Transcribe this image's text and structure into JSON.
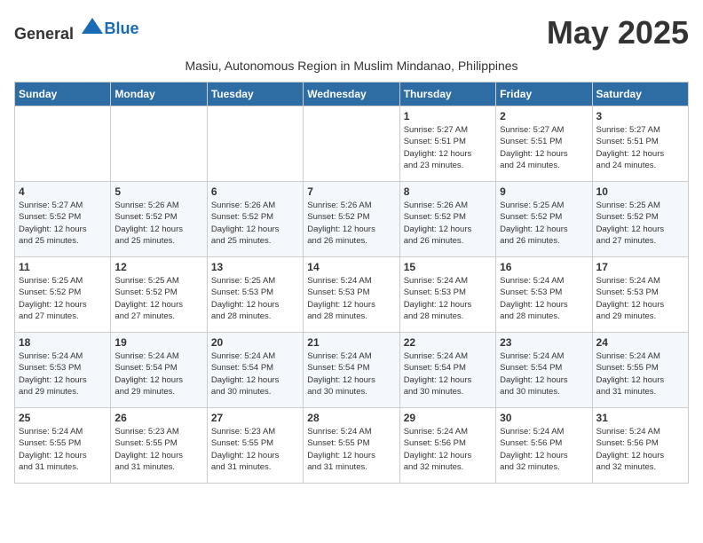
{
  "logo": {
    "general": "General",
    "blue": "Blue"
  },
  "title": "May 2025",
  "subtitle": "Masiu, Autonomous Region in Muslim Mindanao, Philippines",
  "days_of_week": [
    "Sunday",
    "Monday",
    "Tuesday",
    "Wednesday",
    "Thursday",
    "Friday",
    "Saturday"
  ],
  "weeks": [
    [
      {
        "day": "",
        "info": ""
      },
      {
        "day": "",
        "info": ""
      },
      {
        "day": "",
        "info": ""
      },
      {
        "day": "",
        "info": ""
      },
      {
        "day": "1",
        "info": "Sunrise: 5:27 AM\nSunset: 5:51 PM\nDaylight: 12 hours\nand 23 minutes."
      },
      {
        "day": "2",
        "info": "Sunrise: 5:27 AM\nSunset: 5:51 PM\nDaylight: 12 hours\nand 24 minutes."
      },
      {
        "day": "3",
        "info": "Sunrise: 5:27 AM\nSunset: 5:51 PM\nDaylight: 12 hours\nand 24 minutes."
      }
    ],
    [
      {
        "day": "4",
        "info": "Sunrise: 5:27 AM\nSunset: 5:52 PM\nDaylight: 12 hours\nand 25 minutes."
      },
      {
        "day": "5",
        "info": "Sunrise: 5:26 AM\nSunset: 5:52 PM\nDaylight: 12 hours\nand 25 minutes."
      },
      {
        "day": "6",
        "info": "Sunrise: 5:26 AM\nSunset: 5:52 PM\nDaylight: 12 hours\nand 25 minutes."
      },
      {
        "day": "7",
        "info": "Sunrise: 5:26 AM\nSunset: 5:52 PM\nDaylight: 12 hours\nand 26 minutes."
      },
      {
        "day": "8",
        "info": "Sunrise: 5:26 AM\nSunset: 5:52 PM\nDaylight: 12 hours\nand 26 minutes."
      },
      {
        "day": "9",
        "info": "Sunrise: 5:25 AM\nSunset: 5:52 PM\nDaylight: 12 hours\nand 26 minutes."
      },
      {
        "day": "10",
        "info": "Sunrise: 5:25 AM\nSunset: 5:52 PM\nDaylight: 12 hours\nand 27 minutes."
      }
    ],
    [
      {
        "day": "11",
        "info": "Sunrise: 5:25 AM\nSunset: 5:52 PM\nDaylight: 12 hours\nand 27 minutes."
      },
      {
        "day": "12",
        "info": "Sunrise: 5:25 AM\nSunset: 5:52 PM\nDaylight: 12 hours\nand 27 minutes."
      },
      {
        "day": "13",
        "info": "Sunrise: 5:25 AM\nSunset: 5:53 PM\nDaylight: 12 hours\nand 28 minutes."
      },
      {
        "day": "14",
        "info": "Sunrise: 5:24 AM\nSunset: 5:53 PM\nDaylight: 12 hours\nand 28 minutes."
      },
      {
        "day": "15",
        "info": "Sunrise: 5:24 AM\nSunset: 5:53 PM\nDaylight: 12 hours\nand 28 minutes."
      },
      {
        "day": "16",
        "info": "Sunrise: 5:24 AM\nSunset: 5:53 PM\nDaylight: 12 hours\nand 28 minutes."
      },
      {
        "day": "17",
        "info": "Sunrise: 5:24 AM\nSunset: 5:53 PM\nDaylight: 12 hours\nand 29 minutes."
      }
    ],
    [
      {
        "day": "18",
        "info": "Sunrise: 5:24 AM\nSunset: 5:53 PM\nDaylight: 12 hours\nand 29 minutes."
      },
      {
        "day": "19",
        "info": "Sunrise: 5:24 AM\nSunset: 5:54 PM\nDaylight: 12 hours\nand 29 minutes."
      },
      {
        "day": "20",
        "info": "Sunrise: 5:24 AM\nSunset: 5:54 PM\nDaylight: 12 hours\nand 30 minutes."
      },
      {
        "day": "21",
        "info": "Sunrise: 5:24 AM\nSunset: 5:54 PM\nDaylight: 12 hours\nand 30 minutes."
      },
      {
        "day": "22",
        "info": "Sunrise: 5:24 AM\nSunset: 5:54 PM\nDaylight: 12 hours\nand 30 minutes."
      },
      {
        "day": "23",
        "info": "Sunrise: 5:24 AM\nSunset: 5:54 PM\nDaylight: 12 hours\nand 30 minutes."
      },
      {
        "day": "24",
        "info": "Sunrise: 5:24 AM\nSunset: 5:55 PM\nDaylight: 12 hours\nand 31 minutes."
      }
    ],
    [
      {
        "day": "25",
        "info": "Sunrise: 5:24 AM\nSunset: 5:55 PM\nDaylight: 12 hours\nand 31 minutes."
      },
      {
        "day": "26",
        "info": "Sunrise: 5:23 AM\nSunset: 5:55 PM\nDaylight: 12 hours\nand 31 minutes."
      },
      {
        "day": "27",
        "info": "Sunrise: 5:23 AM\nSunset: 5:55 PM\nDaylight: 12 hours\nand 31 minutes."
      },
      {
        "day": "28",
        "info": "Sunrise: 5:24 AM\nSunset: 5:55 PM\nDaylight: 12 hours\nand 31 minutes."
      },
      {
        "day": "29",
        "info": "Sunrise: 5:24 AM\nSunset: 5:56 PM\nDaylight: 12 hours\nand 32 minutes."
      },
      {
        "day": "30",
        "info": "Sunrise: 5:24 AM\nSunset: 5:56 PM\nDaylight: 12 hours\nand 32 minutes."
      },
      {
        "day": "31",
        "info": "Sunrise: 5:24 AM\nSunset: 5:56 PM\nDaylight: 12 hours\nand 32 minutes."
      }
    ]
  ]
}
